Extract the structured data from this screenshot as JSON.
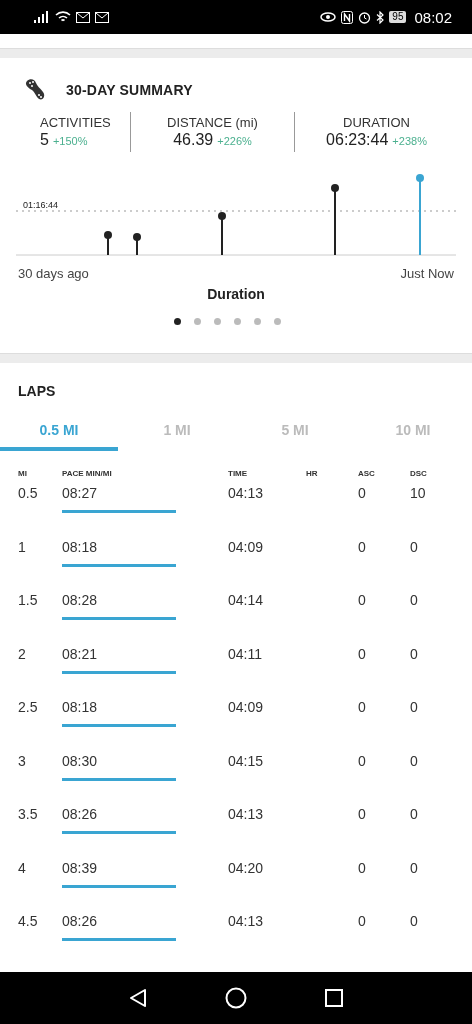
{
  "status_bar": {
    "battery": "95",
    "time": "08:02"
  },
  "summary": {
    "title": "30-DAY SUMMARY",
    "stats": [
      {
        "label": "ACTIVITIES",
        "value": "5",
        "change": "+150%"
      },
      {
        "label": "DISTANCE (mi)",
        "value": "46.39",
        "change": "+226%"
      },
      {
        "label": "DURATION",
        "value": "06:23:44",
        "change": "+238%"
      }
    ],
    "chart": {
      "reference_label": "01:16:44",
      "start_label": "30 days ago",
      "end_label": "Just Now",
      "title": "Duration"
    },
    "pages": [
      {
        "selected": true
      },
      {
        "selected": false
      },
      {
        "selected": false
      },
      {
        "selected": false
      },
      {
        "selected": false
      },
      {
        "selected": false
      }
    ]
  },
  "laps": {
    "title": "LAPS",
    "tabs": [
      {
        "label": "0.5 MI",
        "selected": true
      },
      {
        "label": "1 MI",
        "selected": false
      },
      {
        "label": "5 MI",
        "selected": false
      },
      {
        "label": "10 MI",
        "selected": false
      }
    ],
    "columns": [
      "MI",
      "PACE MIN/MI",
      "TIME",
      "HR",
      "ASC",
      "DSC"
    ],
    "rows": [
      {
        "mi": "0.5",
        "pace": "08:27",
        "time": "04:13",
        "asc": "0",
        "dsc": "10"
      },
      {
        "mi": "1",
        "pace": "08:18",
        "time": "04:09",
        "asc": "0",
        "dsc": "0"
      },
      {
        "mi": "1.5",
        "pace": "08:28",
        "time": "04:14",
        "asc": "0",
        "dsc": "0"
      },
      {
        "mi": "2",
        "pace": "08:21",
        "time": "04:11",
        "asc": "0",
        "dsc": "0"
      },
      {
        "mi": "2.5",
        "pace": "08:18",
        "time": "04:09",
        "asc": "0",
        "dsc": "0"
      },
      {
        "mi": "3",
        "pace": "08:30",
        "time": "04:15",
        "asc": "0",
        "dsc": "0"
      },
      {
        "mi": "3.5",
        "pace": "08:26",
        "time": "04:13",
        "asc": "0",
        "dsc": "0"
      },
      {
        "mi": "4",
        "pace": "08:39",
        "time": "04:20",
        "asc": "0",
        "dsc": "0"
      },
      {
        "mi": "4.5",
        "pace": "08:26",
        "time": "04:13",
        "asc": "0",
        "dsc": "0"
      }
    ]
  }
}
